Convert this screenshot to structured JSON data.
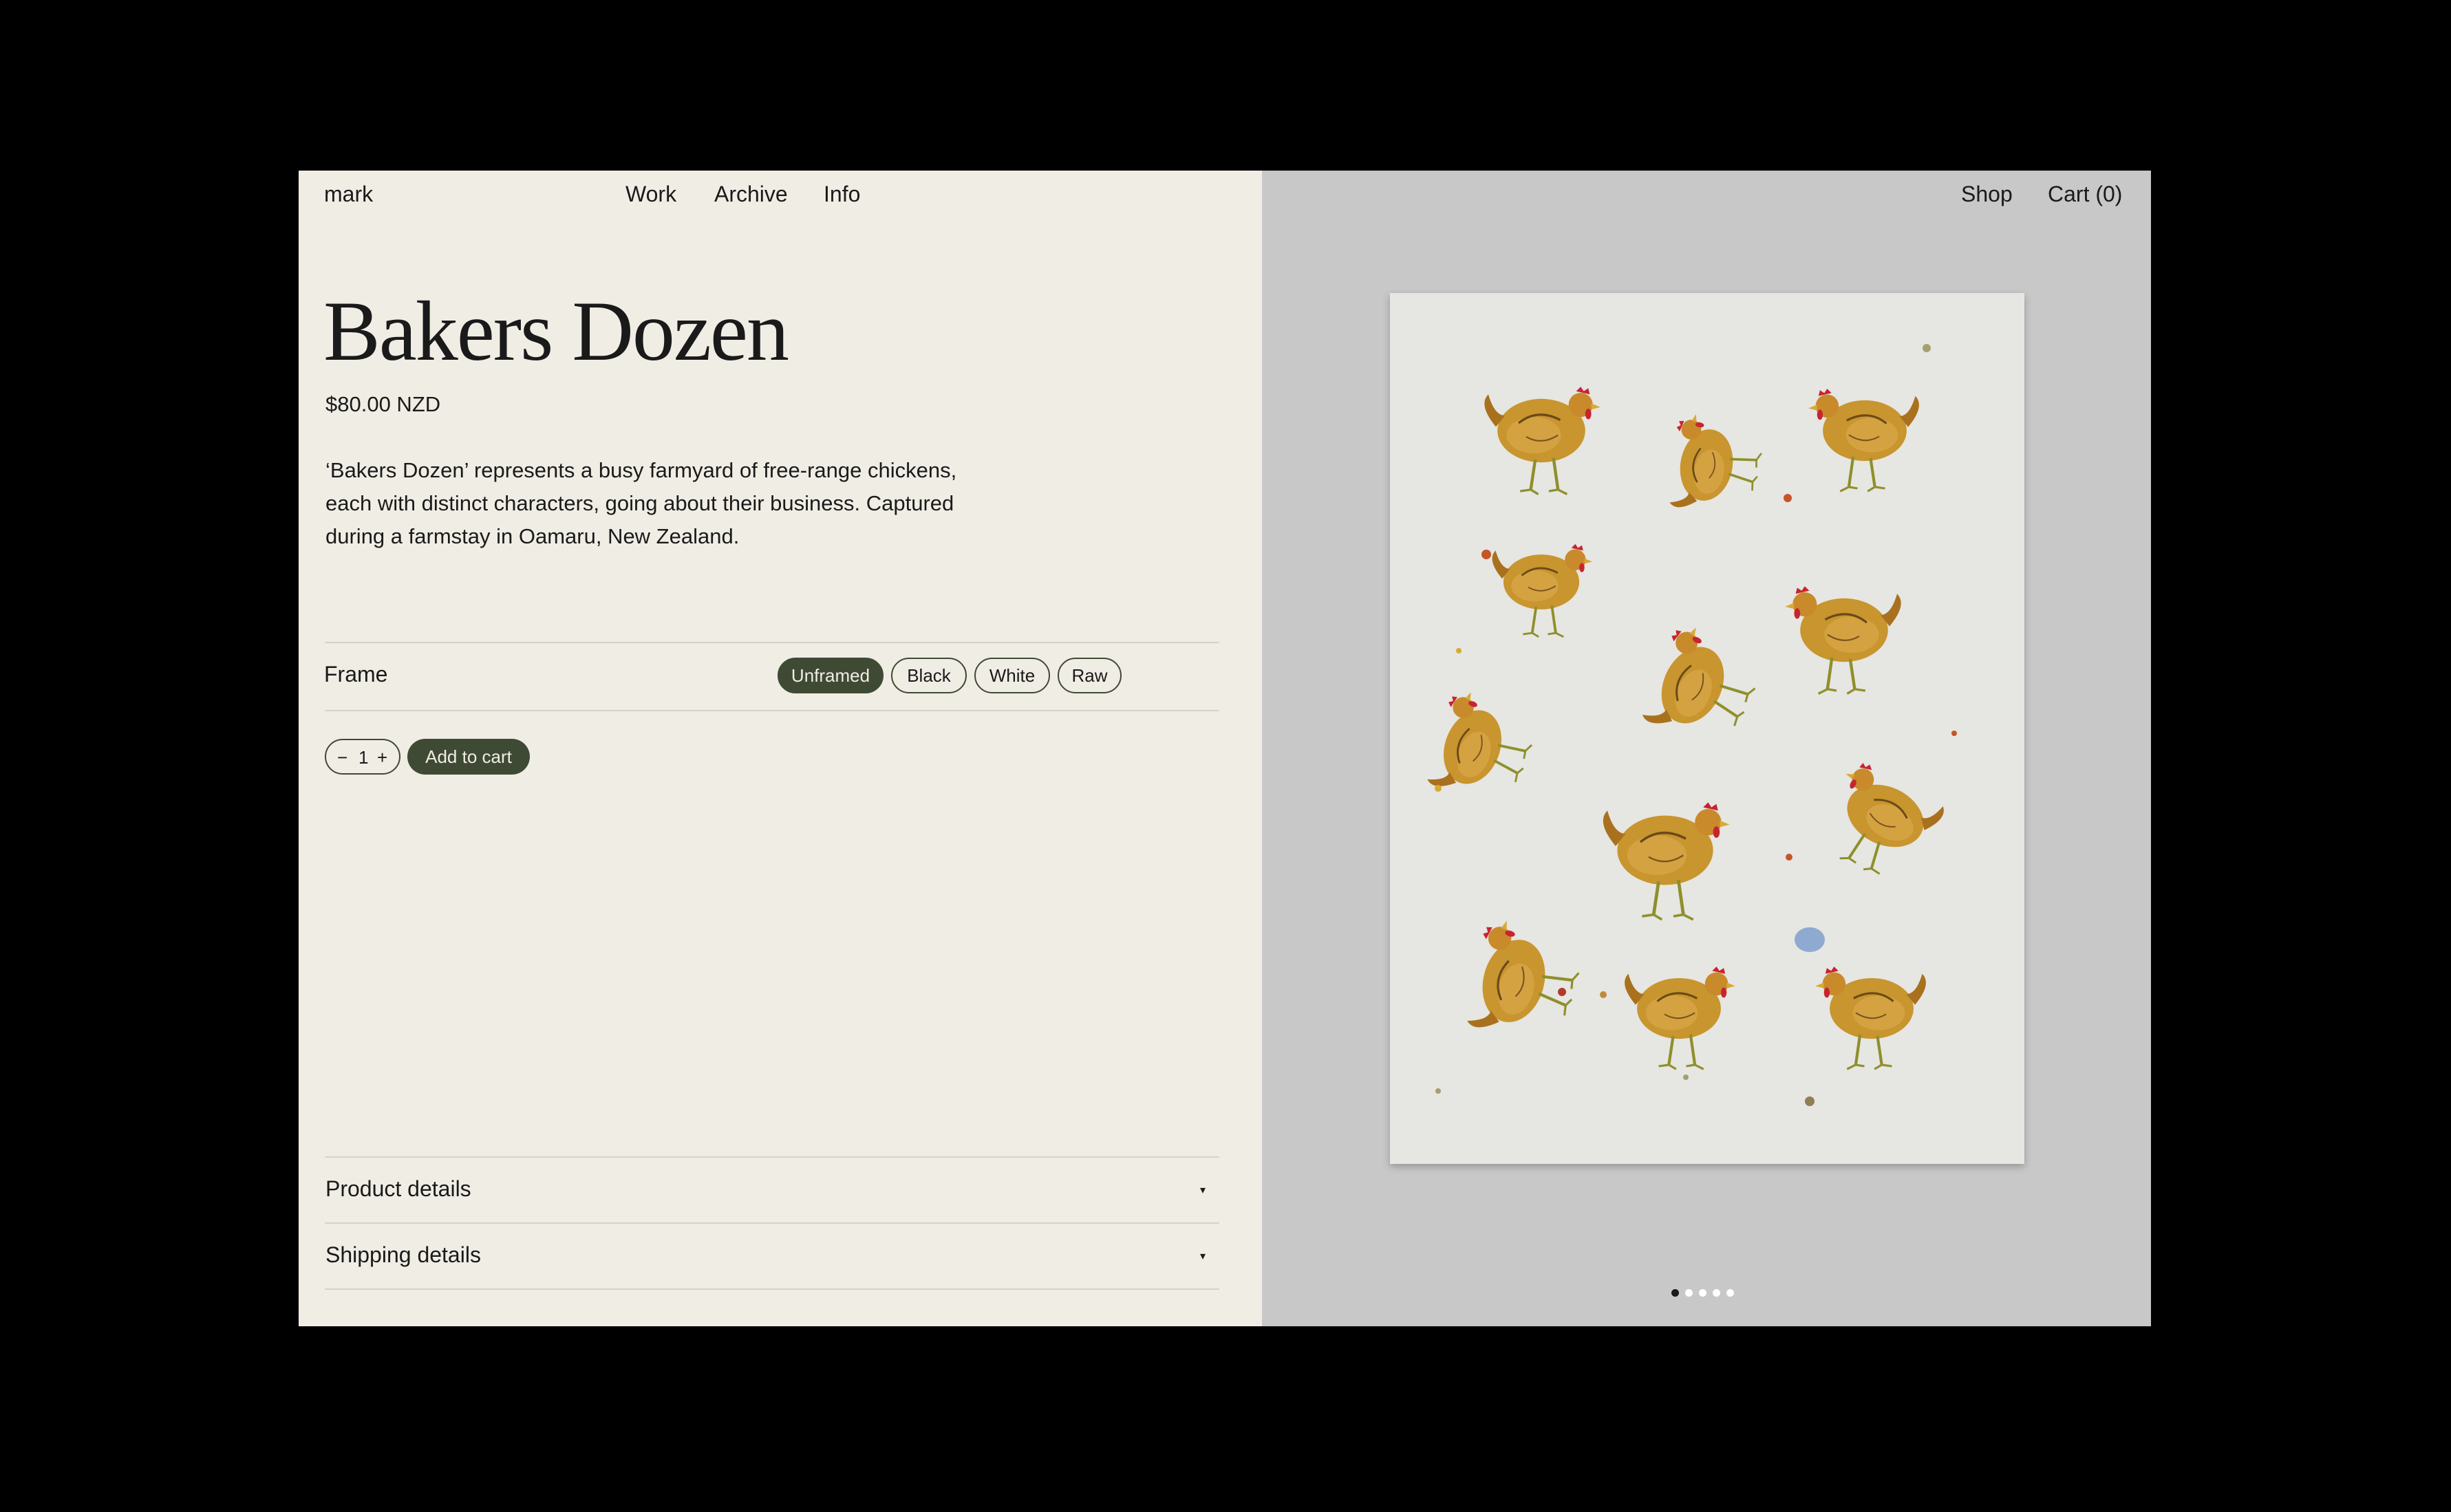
{
  "header": {
    "logo": "mark",
    "nav": [
      "Work",
      "Archive",
      "Info"
    ],
    "shop": "Shop",
    "cart": "Cart (0)"
  },
  "product": {
    "title": "Bakers Dozen",
    "price": "$80.00 NZD",
    "description": "‘Bakers Dozen’ represents a busy farmyard of free-range chickens, each with distinct characters, going about their business. Captured during a farmstay in Oamaru, New Zealand."
  },
  "frame": {
    "label": "Frame",
    "options": [
      "Unframed",
      "Black",
      "White",
      "Raw"
    ],
    "selected": "Unframed"
  },
  "cart_controls": {
    "minus": "−",
    "quantity": "1",
    "plus": "+",
    "add_label": "Add to cart"
  },
  "accordion": [
    {
      "label": "Product details",
      "arrow": "▾"
    },
    {
      "label": "Shipping details",
      "arrow": "▾"
    }
  ],
  "gallery": {
    "image": "illustration of thirteen chickens",
    "slide_count": 5,
    "active_slide": 1
  },
  "colors": {
    "left_bg": "#f0ede5",
    "right_bg": "#c8c8c8",
    "accent": "#3f4a34",
    "print_bg": "#e6e6e2"
  }
}
